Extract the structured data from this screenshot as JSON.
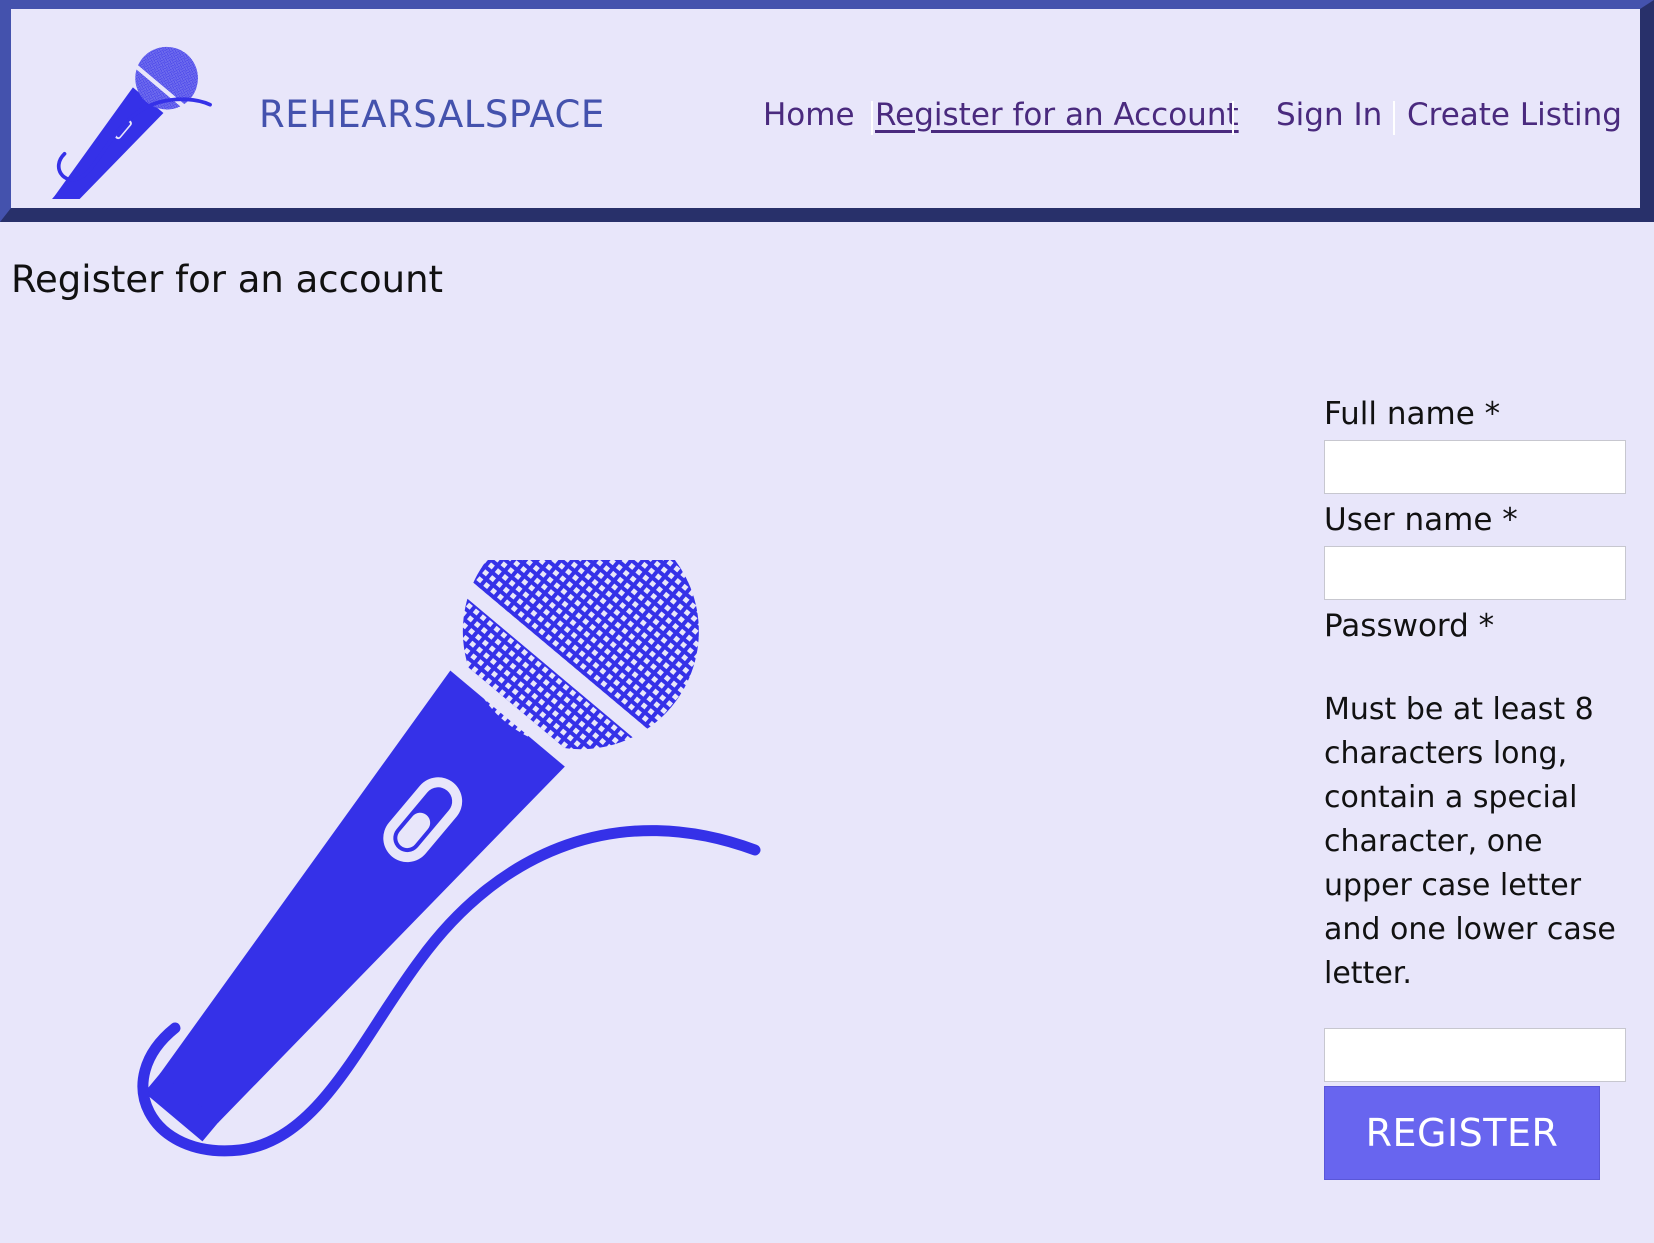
{
  "header": {
    "brand": "REHEARSALSPACE",
    "logo_icon": "microphone-icon",
    "nav": [
      {
        "label": "Home"
      },
      {
        "label": " Register for an Account",
        "active": true
      },
      {
        "label": "Sign In"
      },
      {
        "label": "Create Listing"
      }
    ]
  },
  "page": {
    "title": "Register for an account",
    "hero_icon": "microphone-icon"
  },
  "form": {
    "full_name_label": "Full name *",
    "full_name_value": "",
    "user_name_label": "User name *",
    "user_name_value": "",
    "password_label": "Password *",
    "password_hint": "Must be at least 8 characters long, contain a special character, one upper case letter and one lower case letter.",
    "password_value": "",
    "submit_label": "REGISTER"
  },
  "colors": {
    "background": "#e8e6fa",
    "header_border_light": "#4452ad",
    "header_border_dark": "#28306a",
    "brand": "#4452ad",
    "nav_link": "#4a2a7e",
    "mic": "#3531e8",
    "button": "#6865ef"
  }
}
